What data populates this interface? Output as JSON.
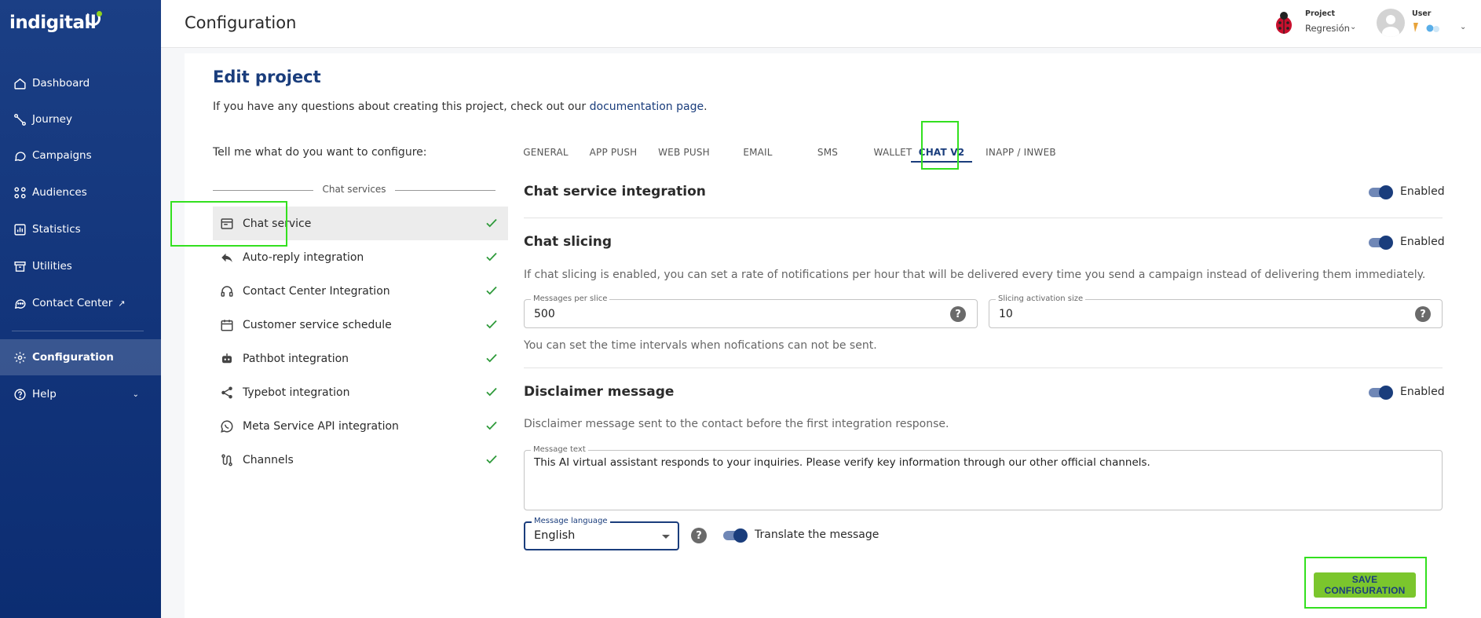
{
  "app": {
    "logo_text": "indigitall"
  },
  "sidebar": {
    "items": [
      {
        "label": "Dashboard",
        "icon": "home-icon"
      },
      {
        "label": "Journey",
        "icon": "journey-icon"
      },
      {
        "label": "Campaigns",
        "icon": "chat-bubble-icon"
      },
      {
        "label": "Audiences",
        "icon": "audiences-icon"
      },
      {
        "label": "Statistics",
        "icon": "bar-chart-icon"
      },
      {
        "label": "Utilities",
        "icon": "archive-icon"
      },
      {
        "label": "Contact Center",
        "icon": "contact-center-icon",
        "external": "↗"
      },
      {
        "label": "Configuration",
        "icon": "gear-icon",
        "active": true
      },
      {
        "label": "Help",
        "icon": "help-circle-icon"
      }
    ]
  },
  "topbar": {
    "title": "Configuration",
    "project_label": "Project",
    "project_value": "Regresión",
    "user_label": "User"
  },
  "main": {
    "edit_title": "Edit project",
    "intro_prefix": "If you have any questions about creating this project, check out our ",
    "intro_link": "documentation page",
    "intro_suffix": ".",
    "configure_label": "Tell me what do you want to configure:",
    "tabs": [
      {
        "label": "GENERAL"
      },
      {
        "label": "APP PUSH"
      },
      {
        "label": "WEB PUSH"
      },
      {
        "label": "EMAIL"
      },
      {
        "label": "SMS"
      },
      {
        "label": "WALLET"
      },
      {
        "label": "CHAT V2",
        "active": true
      },
      {
        "label": "INAPP / INWEB"
      }
    ],
    "services_heading": "Chat services",
    "services": [
      {
        "label": "Chat service",
        "icon": "web-window-icon",
        "active": true
      },
      {
        "label": "Auto-reply integration",
        "icon": "reply-icon"
      },
      {
        "label": "Contact Center Integration",
        "icon": "headset-icon"
      },
      {
        "label": "Customer service schedule",
        "icon": "calendar-icon"
      },
      {
        "label": "Pathbot integration",
        "icon": "robot-icon"
      },
      {
        "label": "Typebot integration",
        "icon": "share-icon"
      },
      {
        "label": "Meta Service API integration",
        "icon": "whatsapp-icon"
      },
      {
        "label": "Channels",
        "icon": "route-icon"
      }
    ],
    "chat_integration": {
      "title": "Chat service integration",
      "status": "Enabled",
      "enabled": true
    },
    "chat_slicing": {
      "title": "Chat slicing",
      "status": "Enabled",
      "enabled": true,
      "description": "If chat slicing is enabled, you can set a rate of notifications per hour that will be delivered every time you send a campaign instead of delivering them immediately.",
      "messages_per_slice_label": "Messages per slice",
      "messages_per_slice_value": "500",
      "activation_size_label": "Slicing activation size",
      "activation_size_value": "10",
      "intervals_note": "You can set the time intervals when nofications can not be sent."
    },
    "disclaimer": {
      "title": "Disclaimer message",
      "status": "Enabled",
      "enabled": true,
      "description": "Disclaimer message sent to the contact before the first integration response.",
      "message_label": "Message text",
      "message_value": "This AI virtual assistant responds to your inquiries. Please verify key information through our other official channels.",
      "language_label": "Message language",
      "language_value": "English",
      "translate_label": "Translate the message",
      "translate_enabled": true
    },
    "save_label": "SAVE CONFIGURATION"
  },
  "colors": {
    "brand_navy": "#1a3d7c",
    "accent_green": "#7bc62d",
    "highlight_green": "#33e01f"
  }
}
